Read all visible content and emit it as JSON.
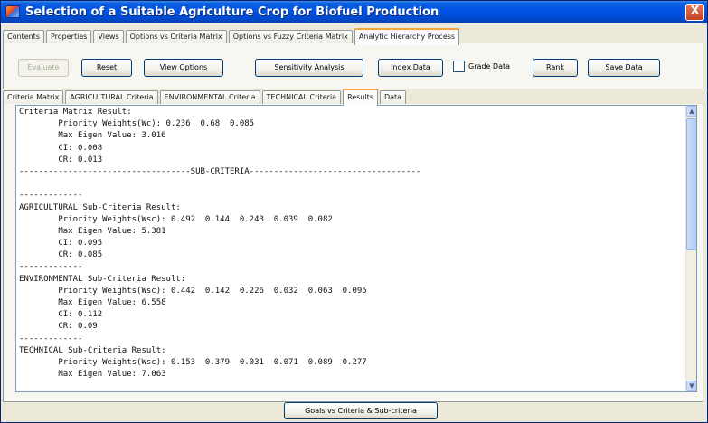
{
  "window": {
    "title": "Selection of a Suitable Agriculture Crop for Biofuel Production",
    "close_glyph": "X",
    "icon": "app-icon"
  },
  "main_tabs": [
    "Contents",
    "Properties",
    "Views",
    "Options vs Criteria Matrix",
    "Options vs Fuzzy Criteria Matrix",
    "Analytic Hierarchy Process"
  ],
  "main_tab_active": "Analytic Hierarchy Process",
  "toolbar": {
    "evaluate": "Evaluate",
    "reset": "Reset",
    "view_options": "View Options",
    "sensitivity": "Sensitivity Analysis",
    "index_data": "Index Data",
    "grade_data": "Grade Data",
    "grade_data_checked": false,
    "rank": "Rank",
    "save_data": "Save Data"
  },
  "sub_tabs": [
    "Criteria Matrix",
    "AGRICULTURAL Criteria",
    "ENVIRONMENTAL Criteria",
    "TECHNICAL Criteria",
    "Results",
    "Data"
  ],
  "sub_tab_active": "Results",
  "results_lines": [
    "Criteria Matrix Result:",
    "        Priority Weights(Wc): 0.236  0.68  0.085",
    "        Max Eigen Value: 3.016",
    "        CI: 0.008",
    "        CR: 0.013",
    "-----------------------------------SUB-CRITERIA-----------------------------------",
    "",
    "-------------",
    "AGRICULTURAL Sub-Criteria Result:",
    "        Priority Weights(Wsc): 0.492  0.144  0.243  0.039  0.082",
    "        Max Eigen Value: 5.381",
    "        CI: 0.095",
    "        CR: 0.085",
    "-------------",
    "ENVIRONMENTAL Sub-Criteria Result:",
    "        Priority Weights(Wsc): 0.442  0.142  0.226  0.032  0.063  0.095",
    "        Max Eigen Value: 6.558",
    "        CI: 0.112",
    "        CR: 0.09",
    "-------------",
    "TECHNICAL Sub-Criteria Result:",
    "        Priority Weights(Wsc): 0.153  0.379  0.031  0.071  0.089  0.277",
    "        Max Eigen Value: 7.063"
  ],
  "bottom_button": "Goals vs Criteria & Sub-criteria",
  "colors": {
    "titlebar": "#0054e3",
    "active_tab_accent": "#f4a43a",
    "window_bg": "#ece9d8"
  }
}
